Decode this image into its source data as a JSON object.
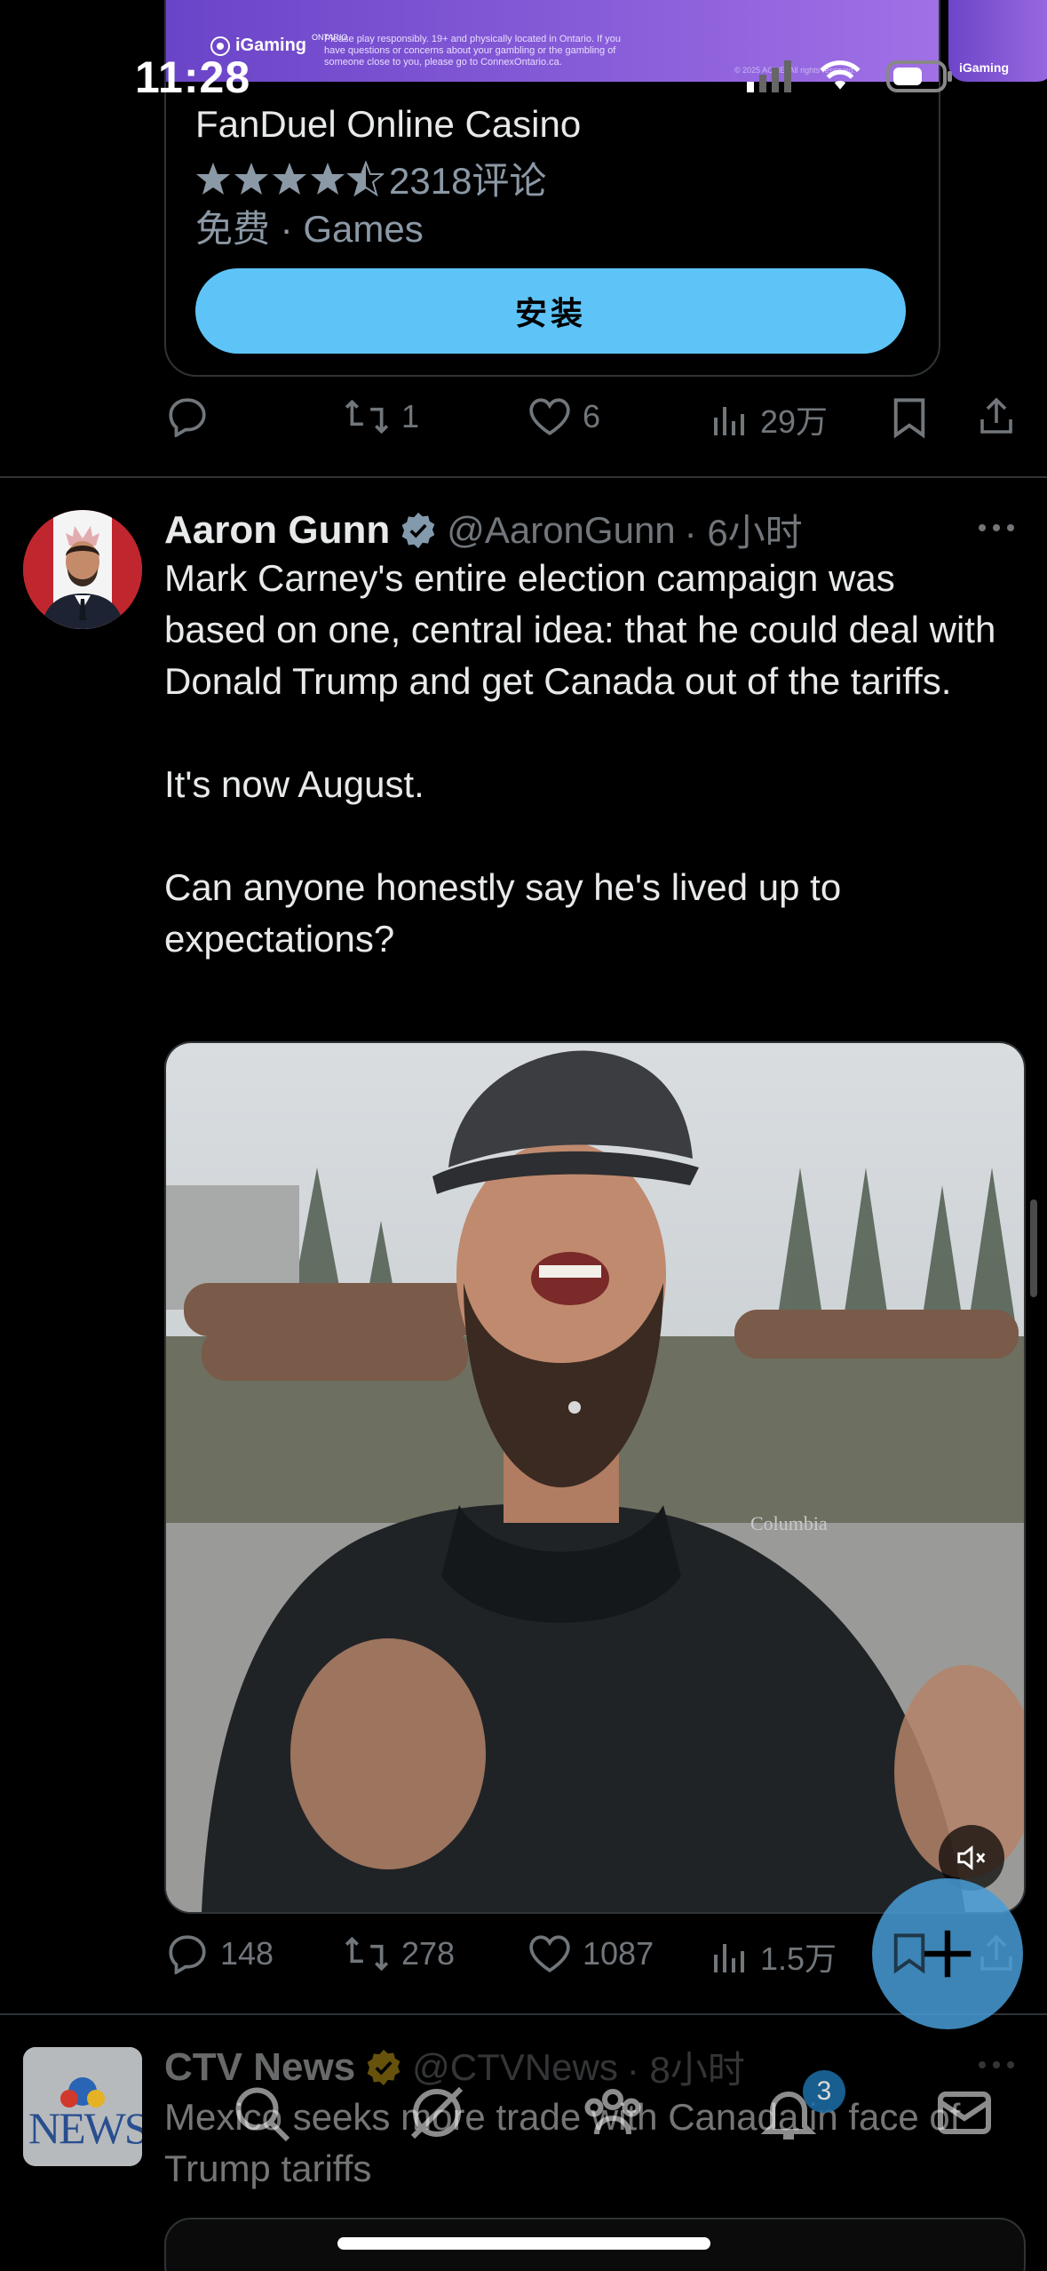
{
  "status": {
    "time": "11:28"
  },
  "ad": {
    "banner_brand": "iGaming",
    "banner_region": "ONTARIO",
    "banner_notice": "Please play responsibly. 19+ and physically located in Ontario. If you have questions or concerns about your gambling or the gambling of someone close to you, please go to ConnexOntario.ca.",
    "banner_copyright": "© 2025 ACME. All rights reserved.",
    "title": "FanDuel Online Casino",
    "rating_count": "2318评论",
    "stars": 4.5,
    "subtitle": "免费 · Games",
    "install_label": "安装",
    "actions": {
      "reply": "",
      "retweet": "1",
      "like": "6",
      "views": "29万"
    }
  },
  "tweet": {
    "name": "Aaron Gunn",
    "handle": "@AaronGunn",
    "time": "· 6小时",
    "text": "Mark Carney's entire election campaign was based on one, central idea: that he could deal with Donald Trump and get Canada out of the tariffs.\n\nIt's now August.\n\nCan anyone honestly say he's lived up to expectations?",
    "jacket_logo": "Columbia",
    "actions": {
      "reply": "148",
      "retweet": "278",
      "like": "1087",
      "views": "1.5万"
    }
  },
  "next_tweet": {
    "name": "CTV News",
    "handle": "@CTVNews",
    "time": "· 8小时",
    "text": "Mexico seeks more trade with Canada in face of Trump tariffs",
    "avatar_text": "NEWS"
  },
  "nav": {
    "notifications_badge": "3"
  },
  "colors": {
    "accent": "#1d9bf0",
    "install": "#5ec4f7",
    "verified": "#829aab",
    "gold": "#e2b719"
  }
}
